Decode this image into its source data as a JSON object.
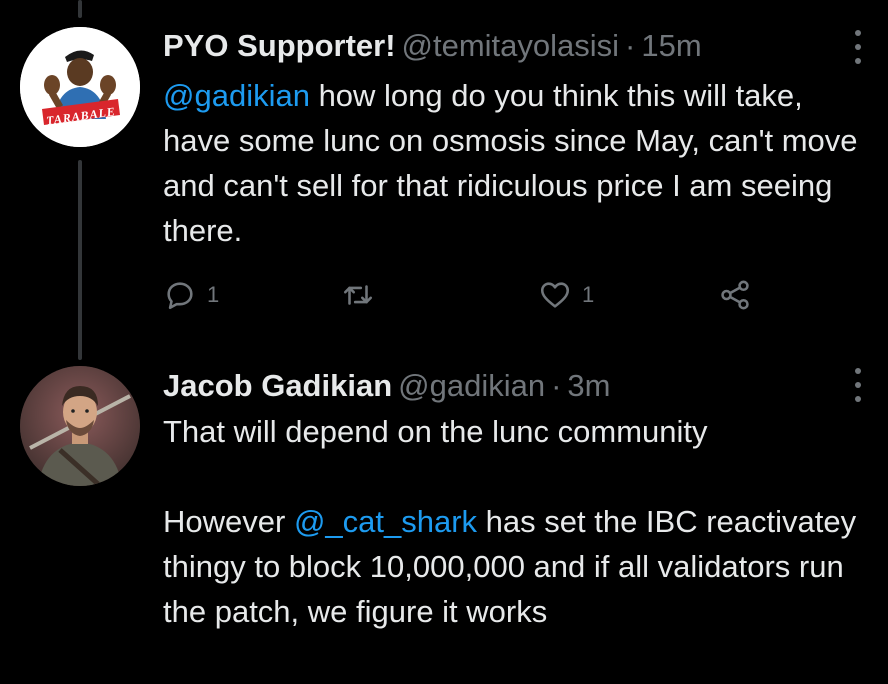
{
  "colors": {
    "background": "#000000",
    "text": "#e7e9ea",
    "muted": "#71767b",
    "link": "#1d9bf0",
    "thread_line": "#333639"
  },
  "tweets": [
    {
      "display_name": "PYO Supporter!",
      "handle": "@temitayolasisi",
      "separator": "·",
      "time": "15m",
      "avatar_icon": "cartoon-man-avatar",
      "avatar_caption": "TARABALE",
      "text": {
        "mention": "@gadikian",
        "body": " how long do you think this will take, have some lunc on osmosis since May, can't move and can't sell for that ridiculous price I am seeing there."
      },
      "actions": {
        "reply_icon": "reply-icon",
        "reply_count": "1",
        "retweet_icon": "retweet-icon",
        "like_icon": "heart-icon",
        "like_count": "1",
        "share_icon": "share-icon"
      }
    },
    {
      "display_name": "Jacob Gadikian",
      "handle": "@gadikian",
      "separator": "·",
      "time": "3m",
      "avatar_icon": "illustrated-portrait-avatar",
      "text": {
        "line1": "That will depend on the lunc community",
        "p2_before": "However ",
        "p2_mention": "@_cat_shark",
        "p2_after": " has set the IBC reactivatey thingy to block 10,000,000 and if all validators run the patch, we figure it works"
      }
    }
  ]
}
